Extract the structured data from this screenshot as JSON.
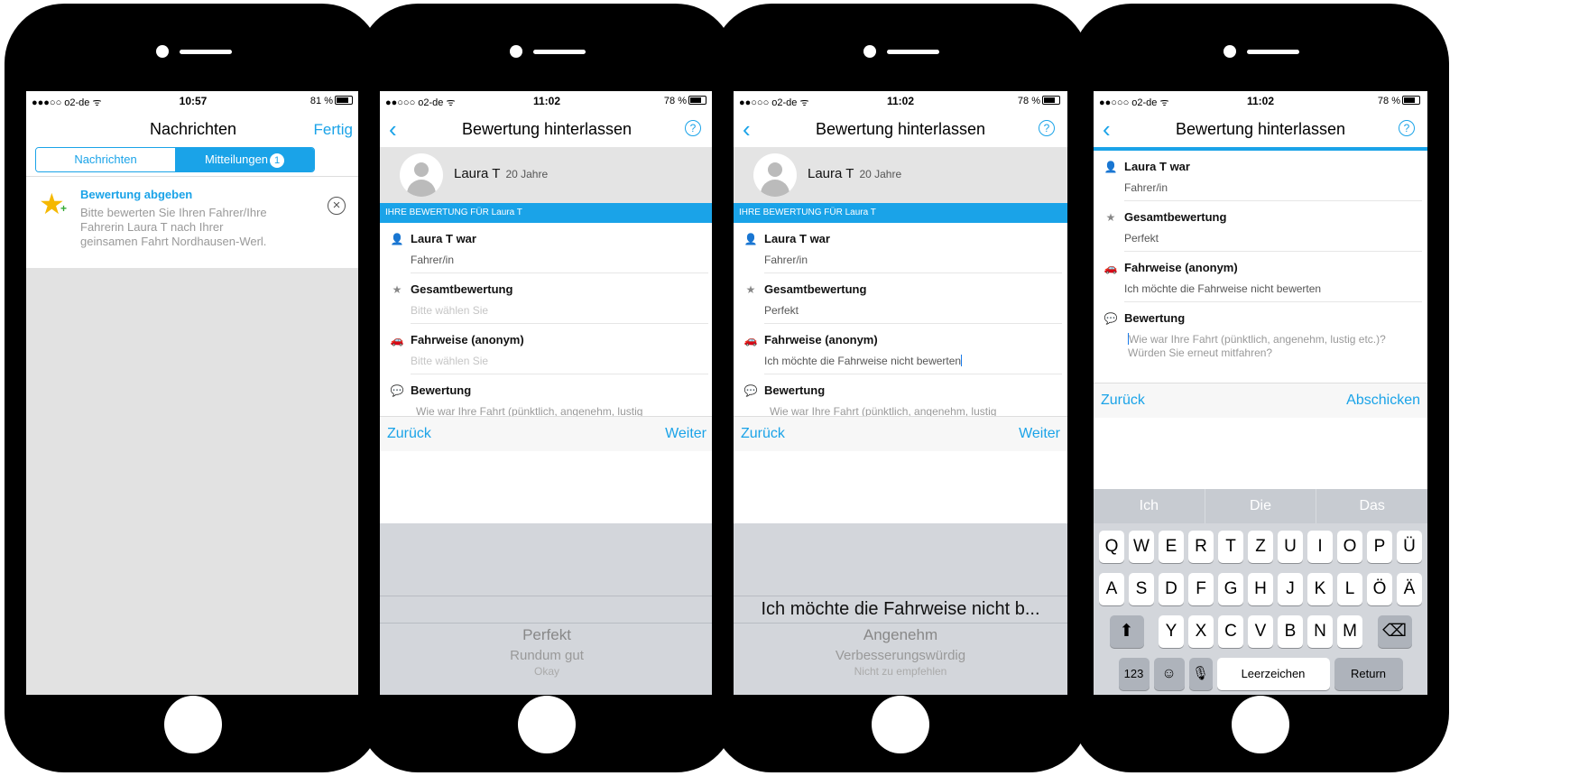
{
  "screens": [
    {
      "status": {
        "carrier": "●●●○○ o2-de ᯤ",
        "time": "10:57",
        "battery": "81 %"
      },
      "nav": {
        "title": "Nachrichten",
        "right": "Fertig"
      },
      "segments": {
        "left": "Nachrichten",
        "right": "Mitteilungen",
        "badge": "1"
      },
      "notification": {
        "title": "Bewertung abgeben",
        "body": "Bitte bewerten Sie Ihren Fahrer/Ihre Fahrerin Laura T nach Ihrer geinsamen Fahrt Nordhausen-Werl."
      }
    },
    {
      "status": {
        "carrier": "●●○○○ o2-de ᯤ",
        "time": "11:02",
        "battery": "78 %"
      },
      "nav": {
        "title": "Bewertung hinterlassen",
        "help": "?"
      },
      "profile": {
        "name": "Laura T",
        "age": "20 Jahre"
      },
      "banner": "IHRE BEWERTUNG FÜR Laura T",
      "fields": [
        {
          "label": "Laura T war",
          "value": "Fahrer/in"
        },
        {
          "label": "Gesamtbewertung",
          "value": "Bitte wählen Sie"
        },
        {
          "label": "Fahrweise (anonym)",
          "value": "Bitte wählen Sie"
        },
        {
          "label": "Bewertung",
          "value": "Wie war Ihre Fahrt (pünktlich, angenehm, lustig"
        }
      ],
      "actions": {
        "back": "Zurück",
        "next": "Weiter"
      },
      "picker": [
        "Perfekt",
        "Rundum gut",
        "Okay"
      ]
    },
    {
      "status": {
        "carrier": "●●○○○ o2-de ᯤ",
        "time": "11:02",
        "battery": "78 %"
      },
      "nav": {
        "title": "Bewertung hinterlassen",
        "help": "?"
      },
      "profile": {
        "name": "Laura T",
        "age": "20 Jahre"
      },
      "banner": "IHRE BEWERTUNG FÜR Laura T",
      "fields": [
        {
          "label": "Laura T war",
          "value": "Fahrer/in"
        },
        {
          "label": "Gesamtbewertung",
          "value": "Perfekt"
        },
        {
          "label": "Fahrweise (anonym)",
          "value": "Ich möchte die Fahrweise nicht bewerten"
        },
        {
          "label": "Bewertung",
          "value": "Wie war Ihre Fahrt (pünktlich, angenehm, lustig"
        }
      ],
      "actions": {
        "back": "Zurück",
        "next": "Weiter"
      },
      "picker": [
        "Ich möchte die Fahrweise nicht b...",
        "Angenehm",
        "Verbesserungswürdig",
        "Nicht zu empfehlen"
      ]
    },
    {
      "status": {
        "carrier": "●●○○○ o2-de ᯤ",
        "time": "11:02",
        "battery": "78 %"
      },
      "nav": {
        "title": "Bewertung hinterlassen",
        "help": "?"
      },
      "fields": [
        {
          "label": "Laura T war",
          "value": "Fahrer/in"
        },
        {
          "label": "Gesamtbewertung",
          "value": "Perfekt"
        },
        {
          "label": "Fahrweise (anonym)",
          "value": "Ich möchte die Fahrweise nicht bewerten"
        },
        {
          "label": "Bewertung",
          "value": "Wie war Ihre Fahrt (pünktlich, angenehm, lustig etc.)? Würden Sie erneut mitfahren?"
        }
      ],
      "actions": {
        "back": "Zurück",
        "next": "Abschicken"
      },
      "keyboard": {
        "suggestions": [
          "Ich",
          "Die",
          "Das"
        ],
        "row1": [
          "Q",
          "W",
          "E",
          "R",
          "T",
          "Z",
          "U",
          "I",
          "O",
          "P",
          "Ü"
        ],
        "row2": [
          "A",
          "S",
          "D",
          "F",
          "G",
          "H",
          "J",
          "K",
          "L",
          "Ö",
          "Ä"
        ],
        "row3": [
          "Y",
          "X",
          "C",
          "V",
          "B",
          "N",
          "M"
        ],
        "numbers": "123",
        "space": "Leerzeichen",
        "return": "Return"
      }
    }
  ],
  "colors": {
    "accent": "#1aa3e8",
    "star": "#f5b800"
  }
}
